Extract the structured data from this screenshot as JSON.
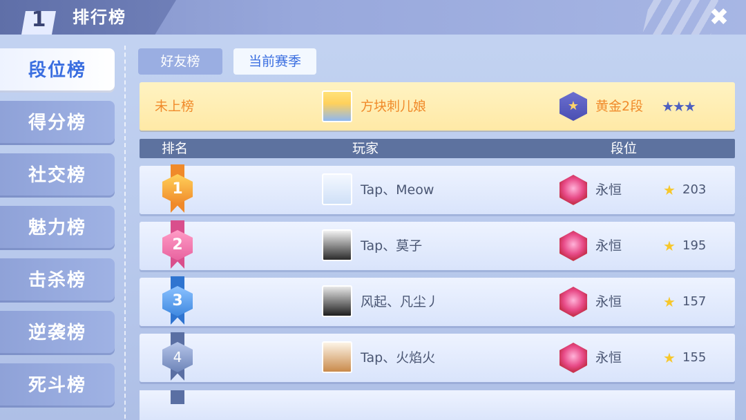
{
  "header": {
    "rank_icon_digit": "1",
    "title": "排行榜",
    "close_glyph": "✖"
  },
  "sidebar": {
    "items": [
      {
        "label": "段位榜",
        "active": true
      },
      {
        "label": "得分榜",
        "active": false
      },
      {
        "label": "社交榜",
        "active": false
      },
      {
        "label": "魅力榜",
        "active": false
      },
      {
        "label": "击杀榜",
        "active": false
      },
      {
        "label": "逆袭榜",
        "active": false
      },
      {
        "label": "死斗榜",
        "active": false
      }
    ]
  },
  "tabs": {
    "friends": "好友榜",
    "season": "当前赛季",
    "selected": "当前赛季"
  },
  "my_row": {
    "rank": "未上榜",
    "name": "方块刺儿娘",
    "tier": "黄金2段",
    "stars": "★★★"
  },
  "table": {
    "columns": [
      "排名",
      "玩家",
      "段位"
    ],
    "rows": [
      {
        "rank": "1",
        "name": "Tap、Meow",
        "tier": "永恒",
        "score": "203"
      },
      {
        "rank": "2",
        "name": "Tap、莫子",
        "tier": "永恒",
        "score": "195"
      },
      {
        "rank": "3",
        "name": "风起、凡尘丿",
        "tier": "永恒",
        "score": "157"
      },
      {
        "rank": "4",
        "name": "Tap、火焰火",
        "tier": "永恒",
        "score": "155"
      }
    ]
  },
  "colors": {
    "accent_blue": "#3a6ee0",
    "my_row_text": "#f08a2a",
    "rank1": "#f39a2d",
    "rank2": "#e8639f",
    "rank3": "#3e88e0",
    "rank4": "#6d84b8"
  },
  "icons": {
    "close": "close-icon",
    "tier": "tier-emblem-icon",
    "star": "star-icon"
  }
}
